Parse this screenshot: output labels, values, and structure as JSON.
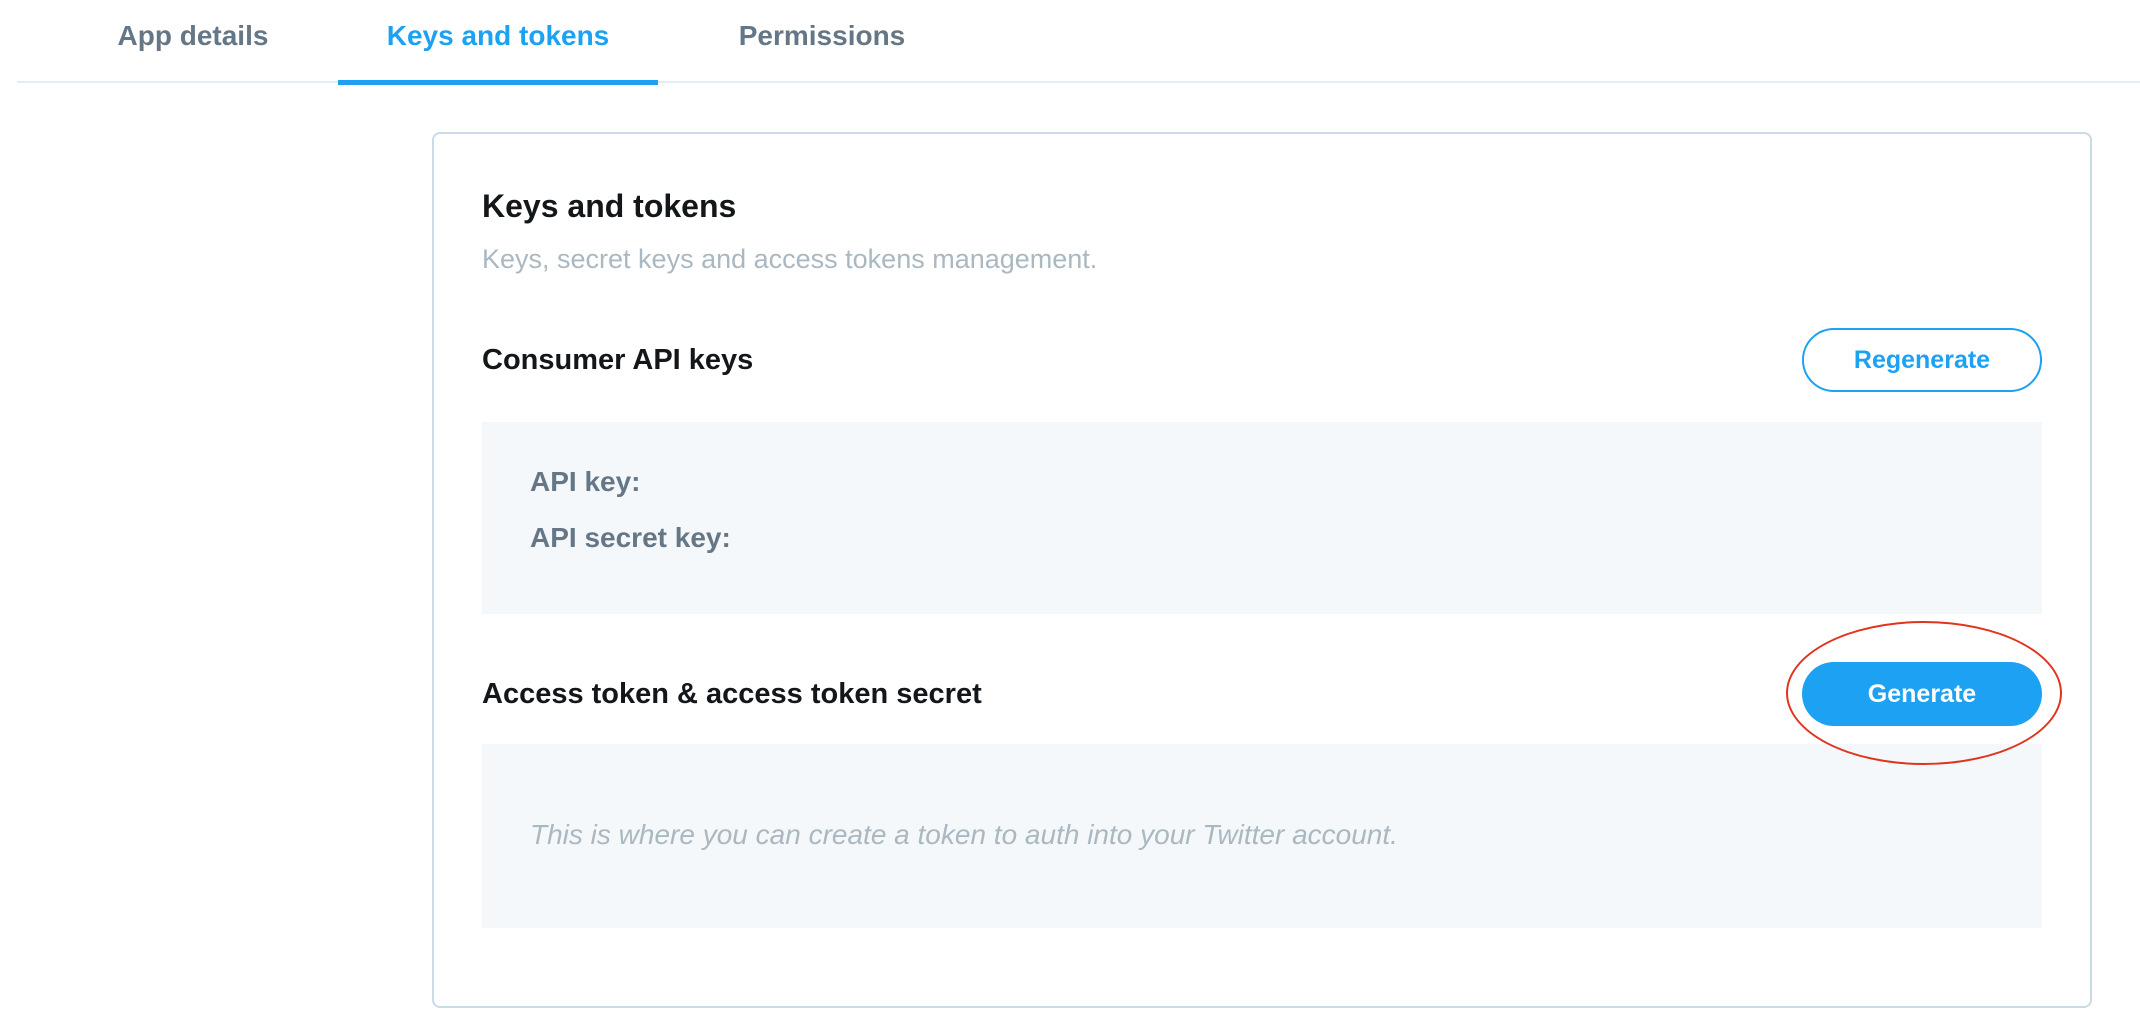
{
  "tabs": [
    {
      "label": "App details",
      "active": false
    },
    {
      "label": "Keys and tokens",
      "active": true
    },
    {
      "label": "Permissions",
      "active": false
    }
  ],
  "card": {
    "title": "Keys and tokens",
    "subtitle": "Keys, secret keys and access tokens management."
  },
  "consumer": {
    "heading": "Consumer API keys",
    "regenerate_label": "Regenerate",
    "api_key_label": "API key:",
    "api_secret_label": "API secret key:"
  },
  "access": {
    "heading": "Access token & access token secret",
    "generate_label": "Generate",
    "placeholder": "This is where you can create a token to auth into your Twitter account."
  },
  "colors": {
    "accent": "#1da1f2",
    "muted_text": "#657786",
    "placeholder_text": "#aab8c2",
    "panel_bg": "#f5f8fa",
    "highlight": "#e0341e"
  }
}
